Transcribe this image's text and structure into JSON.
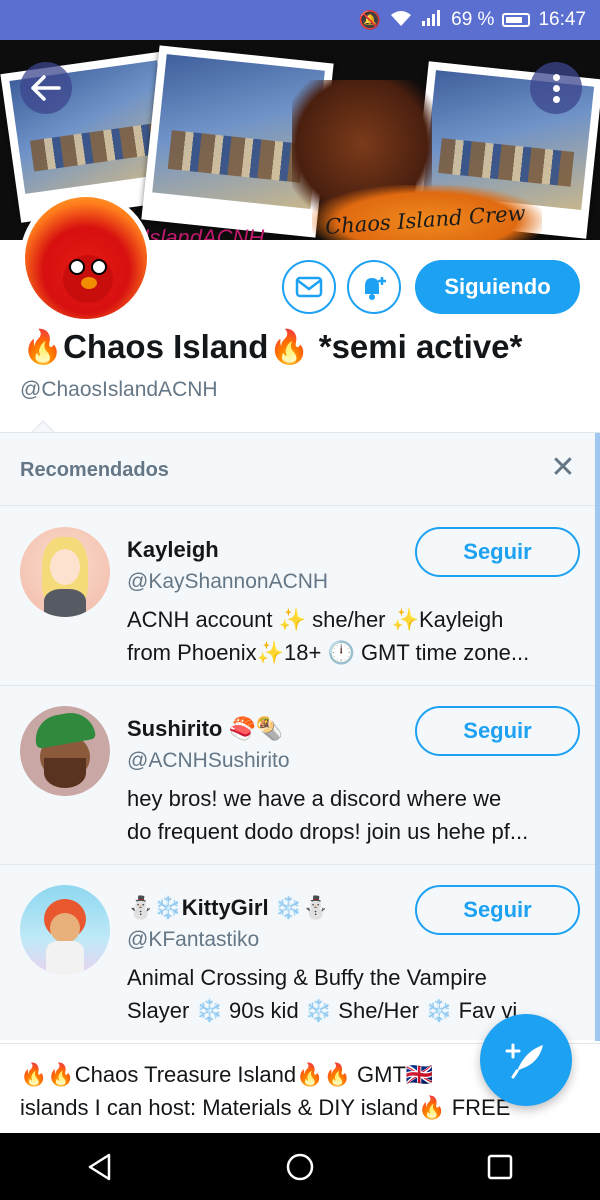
{
  "status_bar": {
    "battery": "69 %",
    "time": "16:47",
    "icons": [
      "mute-icon",
      "wifi-icon",
      "signal-icon",
      "battery-icon"
    ]
  },
  "banner": {
    "caption": "osIslandACNH",
    "crew_text": "Chaos Island Crew"
  },
  "profile": {
    "display_name": "🔥Chaos Island🔥 *semi active*",
    "handle": "@ChaosIslandACNH",
    "following_label": "Siguiendo"
  },
  "recommended": {
    "title": "Recomendados",
    "close_icon": "close-icon",
    "accounts": [
      {
        "name": "Kayleigh",
        "handle": "@KayShannonACNH",
        "bio_line1": "ACNH account ✨ she/her ✨Kayleigh",
        "bio_line2": "from Phoenix✨18+ 🕛 GMT time zone...",
        "follow_label": "Seguir"
      },
      {
        "name": "Sushirito 🍣🌯",
        "handle": "@ACNHSushirito",
        "bio_line1": "hey bros! we have a discord where we",
        "bio_line2": "do frequent dodo drops! join us hehe pf...",
        "follow_label": "Seguir"
      },
      {
        "name": "⛄❄️KittyGirl ❄️⛄",
        "handle": "@KFantastiko",
        "bio_line1": "Animal Crossing & Buffy the Vampire",
        "bio_line2": "Slayer ❄️ 90s kid ❄️ She/Her ❄️ Fav vi...",
        "follow_label": "Seguir"
      }
    ]
  },
  "tweet": {
    "line1": "🔥🔥Chaos Treasure Island🔥🔥 GMT🇬🇧",
    "line2": "islands I can host: Materials & DIY island🔥 FREE"
  },
  "colors": {
    "status_bar": "#5b6fd1",
    "accent": "#1da1f2",
    "muted_text": "#657786",
    "panel_bg": "#f5f8fa"
  }
}
